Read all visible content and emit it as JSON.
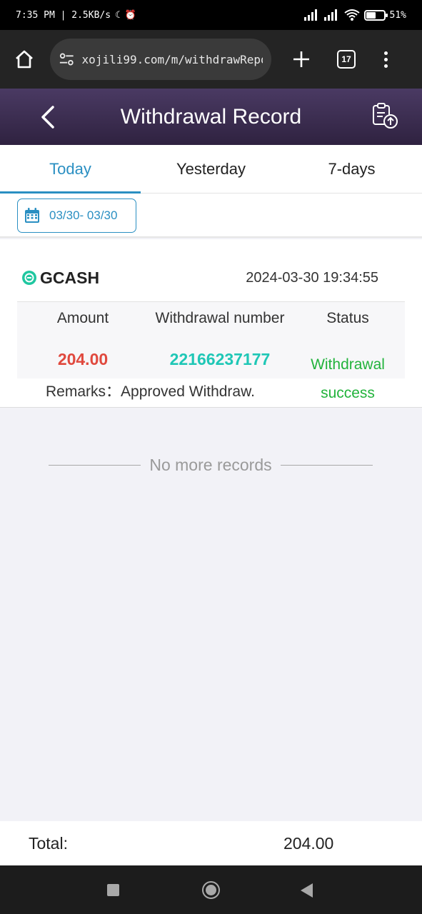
{
  "status_bar": {
    "time_info": "7:35 PM | 2.5KB/s",
    "battery": "51%"
  },
  "browser": {
    "url": "xojili99.com/m/withdrawRepor",
    "tab_count": "17"
  },
  "header": {
    "title": "Withdrawal Record"
  },
  "tabs": [
    {
      "label": "Today",
      "active": true
    },
    {
      "label": "Yesterday",
      "active": false
    },
    {
      "label": "7-days",
      "active": false
    }
  ],
  "date_filter": {
    "range": "03/30- 03/30"
  },
  "record": {
    "method": "GCASH",
    "datetime": "2024-03-30 19:34:55",
    "columns": {
      "amount": "Amount",
      "number": "Withdrawal number",
      "status": "Status"
    },
    "amount": "204.00",
    "withdrawal_number": "22166237177",
    "status_line1": "Withdrawal",
    "status_line2": "success",
    "remarks_label": "Remarks：",
    "remarks_value": "Approved Withdraw."
  },
  "no_more": "No more records",
  "footer": {
    "total_label": "Total:",
    "total_value": "204.00"
  },
  "colors": {
    "accent": "#2a8fc2",
    "amount": "#e0493e",
    "withdrawal_number": "#1fc7b6",
    "status_success": "#22b33c"
  }
}
